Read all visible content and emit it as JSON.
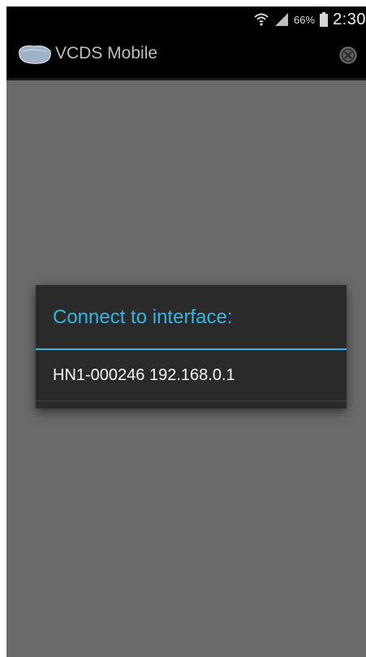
{
  "status_bar": {
    "battery_percent": "66%",
    "time": "2:30",
    "icons": [
      "wifi-icon",
      "signal-icon",
      "battery-icon"
    ]
  },
  "action_bar": {
    "logo_text": "VCDS",
    "title": "VCDS Mobile",
    "close_icon": "close-icon"
  },
  "dialog": {
    "title": "Connect to interface:",
    "items": [
      {
        "label": "HN1-000246 192.168.0.1"
      }
    ]
  },
  "colors": {
    "accent": "#33b5e5",
    "background": "#6a6a6a",
    "dialog": "#2a2a2a",
    "bar": "#000000"
  }
}
